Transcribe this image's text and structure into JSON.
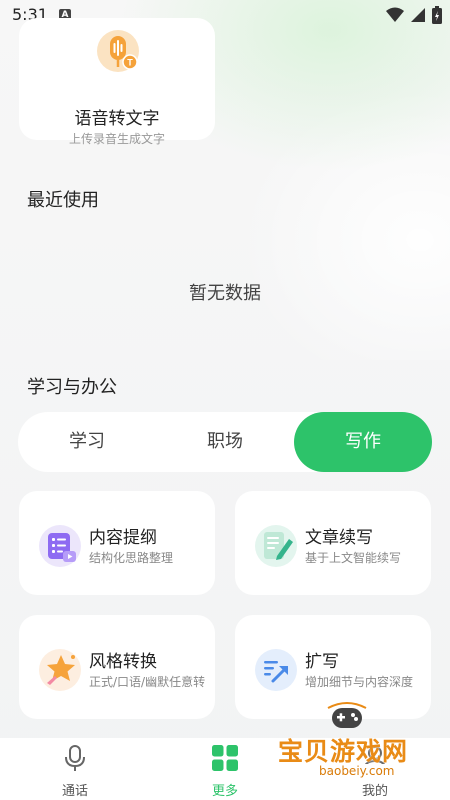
{
  "status_bar": {
    "time": "5:31",
    "notification_badge": "A"
  },
  "voice_card": {
    "title": "语音转文字",
    "subtitle": "上传录音生成文字"
  },
  "recent": {
    "title": "最近使用",
    "empty_text": "暂无数据"
  },
  "study_office": {
    "title": "学习与办公",
    "tabs": [
      {
        "label": "学习",
        "active": false
      },
      {
        "label": "职场",
        "active": false
      },
      {
        "label": "写作",
        "active": true
      }
    ]
  },
  "features": [
    {
      "title": "内容提纲",
      "subtitle": "结构化思路整理",
      "icon": "outline-icon"
    },
    {
      "title": "文章续写",
      "subtitle": "基于上文智能续写",
      "icon": "continue-writing-icon"
    },
    {
      "title": "风格转换",
      "subtitle": "正式/口语/幽默任意转",
      "icon": "style-convert-icon"
    },
    {
      "title": "扩写",
      "subtitle": "增加细节与内容深度",
      "icon": "expand-writing-icon"
    }
  ],
  "bottom_nav": [
    {
      "label": "通话",
      "icon": "microphone-icon",
      "active": false
    },
    {
      "label": "更多",
      "icon": "grid-icon",
      "active": true
    },
    {
      "label": "我的",
      "icon": "profile-icon",
      "active": false
    }
  ],
  "watermark": {
    "text": "宝贝游戏网",
    "url": "baobeiy.com"
  },
  "colors": {
    "accent": "#2dc36a",
    "voice_icon": "#f5a23a",
    "watermark": "#e98b16"
  }
}
